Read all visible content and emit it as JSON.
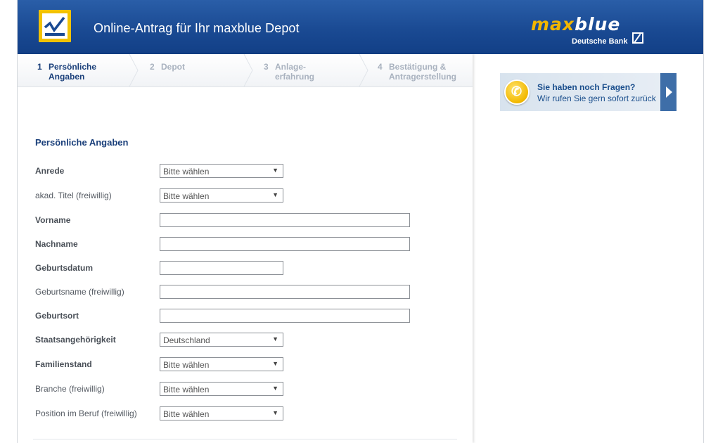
{
  "header": {
    "title": "Online-Antrag für Ihr maxblue Depot",
    "brand_part1": "ma",
    "brand_x": "x",
    "brand_part2": "blue",
    "brand_sub": "Deutsche Bank",
    "colors": {
      "header_blue": "#1a4a93",
      "accent_yellow": "#f2c200"
    }
  },
  "steps": [
    {
      "num": "1",
      "line1": "Persönliche",
      "line2": "Angaben",
      "active": true
    },
    {
      "num": "2",
      "line1": "Depot",
      "line2": "",
      "active": false
    },
    {
      "num": "3",
      "line1": "Anlage-",
      "line2": "erfahrung",
      "active": false
    },
    {
      "num": "4",
      "line1": "Bestätigung &",
      "line2": "Antragerstellung",
      "active": false
    }
  ],
  "section": {
    "title": "Persönliche Angaben"
  },
  "form": {
    "anrede": {
      "label": "Anrede",
      "value": "Bitte wählen"
    },
    "titel": {
      "label": "akad. Titel (freiwillig)",
      "value": "Bitte wählen"
    },
    "vorname": {
      "label": "Vorname",
      "value": ""
    },
    "nachname": {
      "label": "Nachname",
      "value": ""
    },
    "geburtsdatum": {
      "label": "Geburtsdatum",
      "value": ""
    },
    "geburtsname": {
      "label": "Geburtsname (freiwillig)",
      "value": ""
    },
    "geburtsort": {
      "label": "Geburtsort",
      "value": ""
    },
    "staatsangehoerigkeit": {
      "label": "Staatsangehörigkeit",
      "value": "Deutschland"
    },
    "familienstand": {
      "label": "Familienstand",
      "value": "Bitte wählen"
    },
    "branche": {
      "label": "Branche (freiwillig)",
      "value": "Bitte wählen"
    },
    "position": {
      "label": "Position im Beruf (freiwillig)",
      "value": "Bitte wählen"
    }
  },
  "callback": {
    "line1": "Sie haben noch Fragen?",
    "line2": "Wir rufen Sie gern sofort zurück",
    "icon": "phone-icon",
    "arrow_icon": "chevron-right-icon"
  }
}
